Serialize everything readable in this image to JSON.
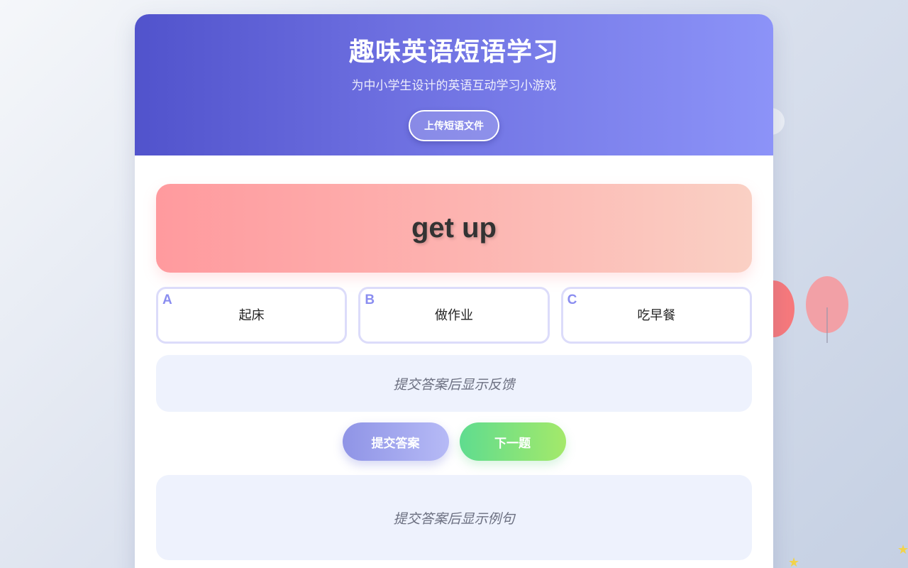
{
  "header": {
    "title": "趣味英语短语学习",
    "subtitle": "为中小学生设计的英语互动学习小游戏",
    "upload_label": "上传短语文件"
  },
  "quiz": {
    "phrase": "get up",
    "options": [
      {
        "letter": "A",
        "text": "起床"
      },
      {
        "letter": "B",
        "text": "做作业"
      },
      {
        "letter": "C",
        "text": "吃早餐"
      }
    ],
    "feedback_placeholder": "提交答案后显示反馈",
    "example_placeholder": "提交答案后显示例句"
  },
  "actions": {
    "submit_label": "提交答案",
    "next_label": "下一题"
  },
  "decorations": {
    "star_glyph": "★",
    "colors": {
      "header_start": "#5153cc",
      "header_end": "#8c93f8",
      "phrase_start": "#ff9a9e",
      "phrase_end": "#fad0c4",
      "submit_start": "#8f94e6",
      "next_start": "#5fdc8f",
      "option_border": "#dcdcfa"
    }
  }
}
